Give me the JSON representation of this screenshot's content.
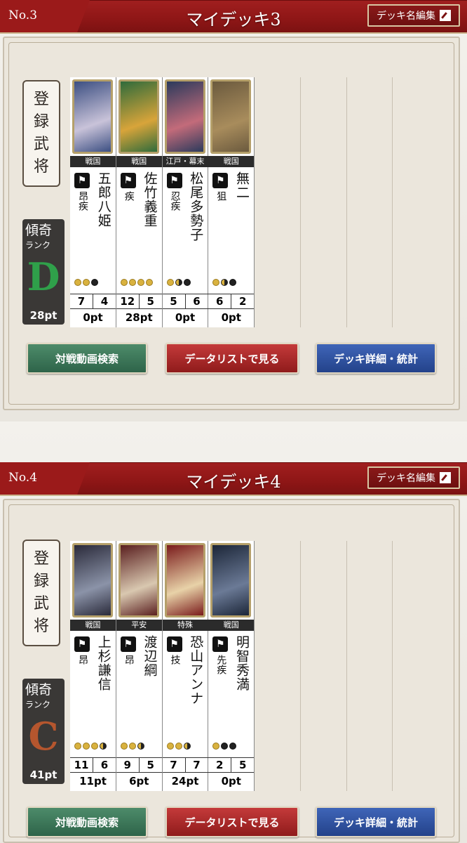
{
  "decks": [
    {
      "no": "No.3",
      "title": "マイデッキ3",
      "rename_label": "デッキ名編集",
      "registered_label": [
        "登",
        "録",
        "武",
        "将"
      ],
      "rank_title": "傾奇",
      "rank_sub": "ランク",
      "rank_letter": "D",
      "rank_points": "28pt",
      "cards": [
        {
          "era": "戦国",
          "name": "五郎八姫",
          "skills": "昂疾",
          "cost": [
            "full",
            "full",
            "black"
          ],
          "atk": "7",
          "def": "4",
          "pt": "0pt",
          "colors": [
            "#3c4f82",
            "#c9c3d9"
          ]
        },
        {
          "era": "戦国",
          "name": "佐竹義重",
          "skills": "疾",
          "cost": [
            "full",
            "full",
            "full",
            "full"
          ],
          "atk": "12",
          "def": "5",
          "pt": "28pt",
          "colors": [
            "#2f6b3b",
            "#d8a43a"
          ]
        },
        {
          "era": "江戸・幕末",
          "name": "松尾多勢子",
          "skills": "忍疾",
          "cost": [
            "full",
            "half",
            "black"
          ],
          "atk": "5",
          "def": "6",
          "pt": "0pt",
          "colors": [
            "#2b3a5c",
            "#c36b7a"
          ]
        },
        {
          "era": "戦国",
          "name": "無二",
          "skills": "狙",
          "cost": [
            "full",
            "half",
            "black"
          ],
          "atk": "6",
          "def": "2",
          "pt": "0pt",
          "colors": [
            "#6b5a3e",
            "#a88c5c"
          ]
        }
      ],
      "buttons": {
        "video": "対戦動画検索",
        "list": "データリストで見る",
        "detail": "デッキ詳細・統計"
      }
    },
    {
      "no": "No.4",
      "title": "マイデッキ4",
      "rename_label": "デッキ名編集",
      "registered_label": [
        "登",
        "録",
        "武",
        "将"
      ],
      "rank_title": "傾奇",
      "rank_sub": "ランク",
      "rank_letter": "C",
      "rank_points": "41pt",
      "cards": [
        {
          "era": "戦国",
          "name": "上杉謙信",
          "skills": "昂",
          "cost": [
            "full",
            "full",
            "full",
            "half"
          ],
          "atk": "11",
          "def": "6",
          "pt": "11pt",
          "colors": [
            "#2a2a3a",
            "#8b93a8"
          ]
        },
        {
          "era": "平安",
          "name": "渡辺綱",
          "skills": "昂",
          "cost": [
            "full",
            "full",
            "half"
          ],
          "atk": "9",
          "def": "5",
          "pt": "6pt",
          "colors": [
            "#5a1f1f",
            "#d9c8b0"
          ]
        },
        {
          "era": "特殊",
          "name": "恐山アンナ",
          "skills": "技",
          "cost": [
            "full",
            "full",
            "half"
          ],
          "atk": "7",
          "def": "7",
          "pt": "24pt",
          "colors": [
            "#7a1b1b",
            "#e8d2a8"
          ]
        },
        {
          "era": "戦国",
          "name": "明智秀満",
          "skills": "先疾",
          "cost": [
            "full",
            "black",
            "black"
          ],
          "atk": "2",
          "def": "5",
          "pt": "0pt",
          "colors": [
            "#1c2638",
            "#6b7a96"
          ]
        }
      ],
      "buttons": {
        "video": "対戦動画検索",
        "list": "データリストで見る",
        "detail": "デッキ詳細・統計"
      }
    }
  ]
}
